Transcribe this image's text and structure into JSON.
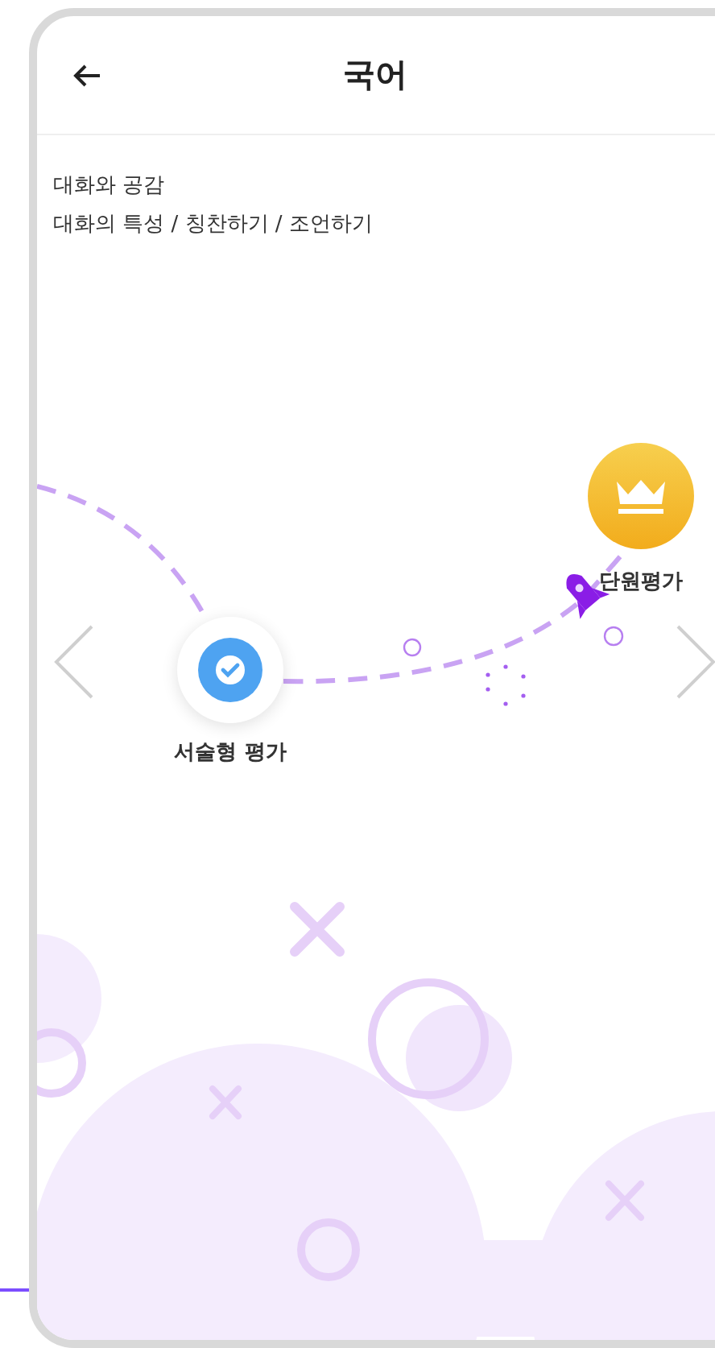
{
  "header": {
    "title": "국어"
  },
  "breadcrumb": [
    "대화와 공감",
    "대화의 특성 / 칭찬하기 / 조언하기"
  ],
  "nodes": [
    {
      "kind": "check",
      "label": "서술형 평가"
    },
    {
      "kind": "crown",
      "label": "단원평가"
    }
  ]
}
